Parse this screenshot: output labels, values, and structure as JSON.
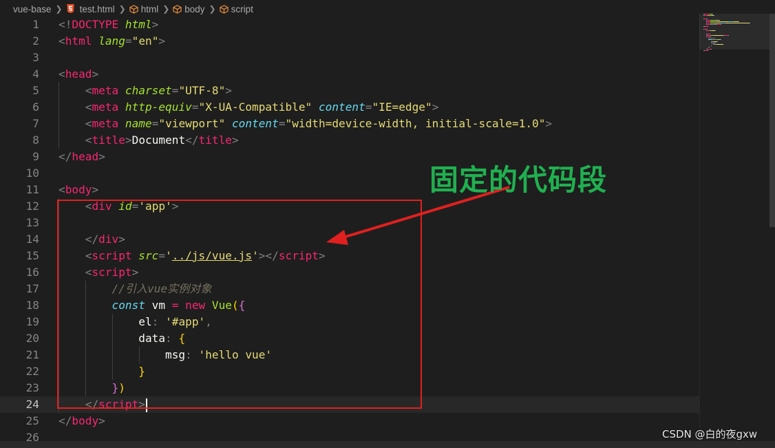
{
  "breadcrumb": {
    "items": [
      {
        "label": "vue-base",
        "icon": "none"
      },
      {
        "label": "test.html",
        "icon": "html5-icon"
      },
      {
        "label": "html",
        "icon": "element-cube-icon"
      },
      {
        "label": "body",
        "icon": "element-cube-icon"
      },
      {
        "label": "script",
        "icon": "element-cube-icon"
      }
    ]
  },
  "editor": {
    "current_line": "24",
    "line_numbers": [
      "1",
      "2",
      "3",
      "4",
      "5",
      "6",
      "7",
      "8",
      "9",
      "10",
      "11",
      "12",
      "13",
      "14",
      "15",
      "16",
      "17",
      "18",
      "19",
      "20",
      "21",
      "22",
      "23",
      "24",
      "25",
      "26"
    ],
    "lines": [
      [
        [
          "t-punc",
          "<!"
        ],
        [
          "t-tag",
          "DOCTYPE "
        ],
        [
          "t-attr",
          "html"
        ],
        [
          "t-punc",
          ">"
        ]
      ],
      [
        [
          "t-punc",
          "<"
        ],
        [
          "t-tag",
          "html "
        ],
        [
          "t-attr",
          "lang"
        ],
        [
          "t-punc",
          "="
        ],
        [
          "t-str",
          "\"en\""
        ],
        [
          "t-punc",
          ">"
        ]
      ],
      [],
      [
        [
          "t-punc",
          "<"
        ],
        [
          "t-tag",
          "head"
        ],
        [
          "t-punc",
          ">"
        ]
      ],
      [
        [
          "t-text",
          "    "
        ],
        [
          "t-punc",
          "<"
        ],
        [
          "t-tag",
          "meta "
        ],
        [
          "t-attr",
          "charset"
        ],
        [
          "t-punc",
          "="
        ],
        [
          "t-str",
          "\"UTF-8\""
        ],
        [
          "t-punc",
          ">"
        ]
      ],
      [
        [
          "t-text",
          "    "
        ],
        [
          "t-punc",
          "<"
        ],
        [
          "t-tag",
          "meta "
        ],
        [
          "t-attr",
          "http-equiv"
        ],
        [
          "t-punc",
          "="
        ],
        [
          "t-str",
          "\"X-UA-Compatible\" "
        ],
        [
          "t-attr2",
          "content"
        ],
        [
          "t-punc",
          "="
        ],
        [
          "t-str",
          "\"IE=edge\""
        ],
        [
          "t-punc",
          ">"
        ]
      ],
      [
        [
          "t-text",
          "    "
        ],
        [
          "t-punc",
          "<"
        ],
        [
          "t-tag",
          "meta "
        ],
        [
          "t-attr",
          "name"
        ],
        [
          "t-punc",
          "="
        ],
        [
          "t-str",
          "\"viewport\" "
        ],
        [
          "t-attr2",
          "content"
        ],
        [
          "t-punc",
          "="
        ],
        [
          "t-str",
          "\"width=device-width, initial-scale=1.0\""
        ],
        [
          "t-punc",
          ">"
        ]
      ],
      [
        [
          "t-text",
          "    "
        ],
        [
          "t-punc",
          "<"
        ],
        [
          "t-tag",
          "title"
        ],
        [
          "t-punc",
          ">"
        ],
        [
          "t-text",
          "Document"
        ],
        [
          "t-punc",
          "</"
        ],
        [
          "t-tag",
          "title"
        ],
        [
          "t-punc",
          ">"
        ]
      ],
      [
        [
          "t-punc",
          "</"
        ],
        [
          "t-tag",
          "head"
        ],
        [
          "t-punc",
          ">"
        ]
      ],
      [],
      [
        [
          "t-punc",
          "<"
        ],
        [
          "t-tag",
          "body"
        ],
        [
          "t-punc",
          ">"
        ]
      ],
      [
        [
          "t-text",
          "    "
        ],
        [
          "t-punc",
          "<"
        ],
        [
          "t-tag",
          "div "
        ],
        [
          "t-attr",
          "id"
        ],
        [
          "t-punc",
          "="
        ],
        [
          "t-str",
          "'app'"
        ],
        [
          "t-punc",
          ">"
        ]
      ],
      [],
      [
        [
          "t-text",
          "    "
        ],
        [
          "t-punc",
          "</"
        ],
        [
          "t-tag",
          "div"
        ],
        [
          "t-punc",
          ">"
        ]
      ],
      [
        [
          "t-text",
          "    "
        ],
        [
          "t-punc",
          "<"
        ],
        [
          "t-tag",
          "script "
        ],
        [
          "t-attr",
          "src"
        ],
        [
          "t-punc",
          "="
        ],
        [
          "t-str",
          "'"
        ],
        [
          "t-link",
          "../js/vue.js"
        ],
        [
          "t-str",
          "'"
        ],
        [
          "t-punc",
          "></"
        ],
        [
          "t-tag",
          "script"
        ],
        [
          "t-punc",
          ">"
        ]
      ],
      [
        [
          "t-text",
          "    "
        ],
        [
          "t-punc",
          "<"
        ],
        [
          "t-tag",
          "script"
        ],
        [
          "t-punc",
          ">"
        ]
      ],
      [
        [
          "t-text",
          "        "
        ],
        [
          "t-comment",
          "//引入vue实例对象"
        ]
      ],
      [
        [
          "t-text",
          "        "
        ],
        [
          "t-kw",
          "const "
        ],
        [
          "t-var",
          "vm "
        ],
        [
          "t-op",
          "= "
        ],
        [
          "t-op",
          "new "
        ],
        [
          "t-cls",
          "Vue"
        ],
        [
          "t-brace",
          "("
        ],
        [
          "t-brace2",
          "{"
        ]
      ],
      [
        [
          "t-text",
          "            "
        ],
        [
          "t-prop",
          "el"
        ],
        [
          "t-punc",
          ": "
        ],
        [
          "t-str",
          "'#app'"
        ],
        [
          "t-punc",
          ","
        ]
      ],
      [
        [
          "t-text",
          "            "
        ],
        [
          "t-prop",
          "data"
        ],
        [
          "t-punc",
          ": "
        ],
        [
          "t-brace3",
          "{"
        ]
      ],
      [
        [
          "t-text",
          "                "
        ],
        [
          "t-prop",
          "msg"
        ],
        [
          "t-punc",
          ": "
        ],
        [
          "t-str",
          "'hello vue'"
        ]
      ],
      [
        [
          "t-text",
          "            "
        ],
        [
          "t-brace3",
          "}"
        ]
      ],
      [
        [
          "t-text",
          "        "
        ],
        [
          "t-brace2",
          "}"
        ],
        [
          "t-brace",
          ")"
        ]
      ],
      [
        [
          "t-text",
          "    "
        ],
        [
          "t-punc",
          "</"
        ],
        [
          "t-tag",
          "script"
        ],
        [
          "t-punc",
          ">"
        ]
      ],
      [
        [
          "t-punc",
          "</"
        ],
        [
          "t-tag",
          "body"
        ],
        [
          "t-punc",
          ">"
        ]
      ],
      []
    ]
  },
  "annotation": {
    "text": "固定的代码段",
    "color": "#20b050",
    "box_color": "#e02020"
  },
  "watermark": "CSDN @白的夜gxw"
}
